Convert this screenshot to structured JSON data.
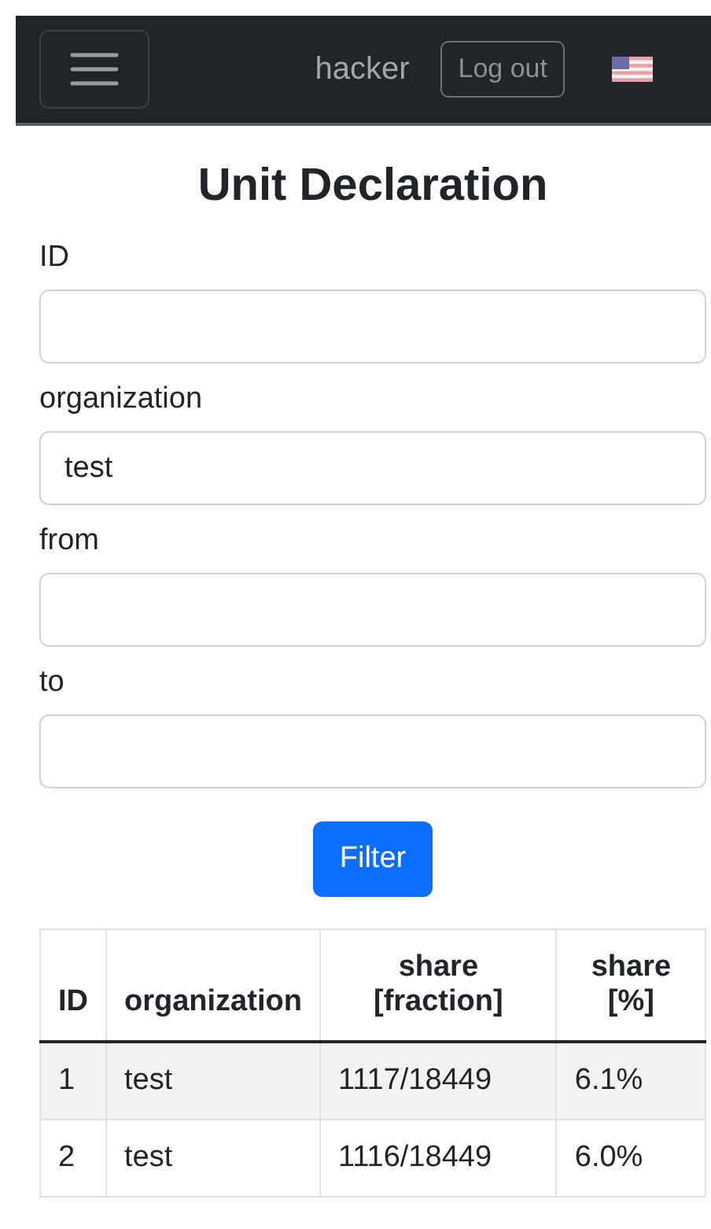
{
  "navbar": {
    "user": "hacker",
    "logout": "Log out"
  },
  "title": "Unit Declaration",
  "fields": [
    {
      "label": "ID"
    },
    {
      "label": "organization",
      "value": "test"
    },
    {
      "label": "from"
    },
    {
      "label": "to"
    }
  ],
  "filter_button": "Filter",
  "table": {
    "columns": [
      "ID",
      "organization",
      "share [fraction]",
      "share [%]"
    ],
    "rows": [
      [
        "1",
        "test",
        "1117/18449",
        "6.1%"
      ],
      [
        "2",
        "test",
        "1116/18449",
        "6.0%"
      ]
    ]
  }
}
